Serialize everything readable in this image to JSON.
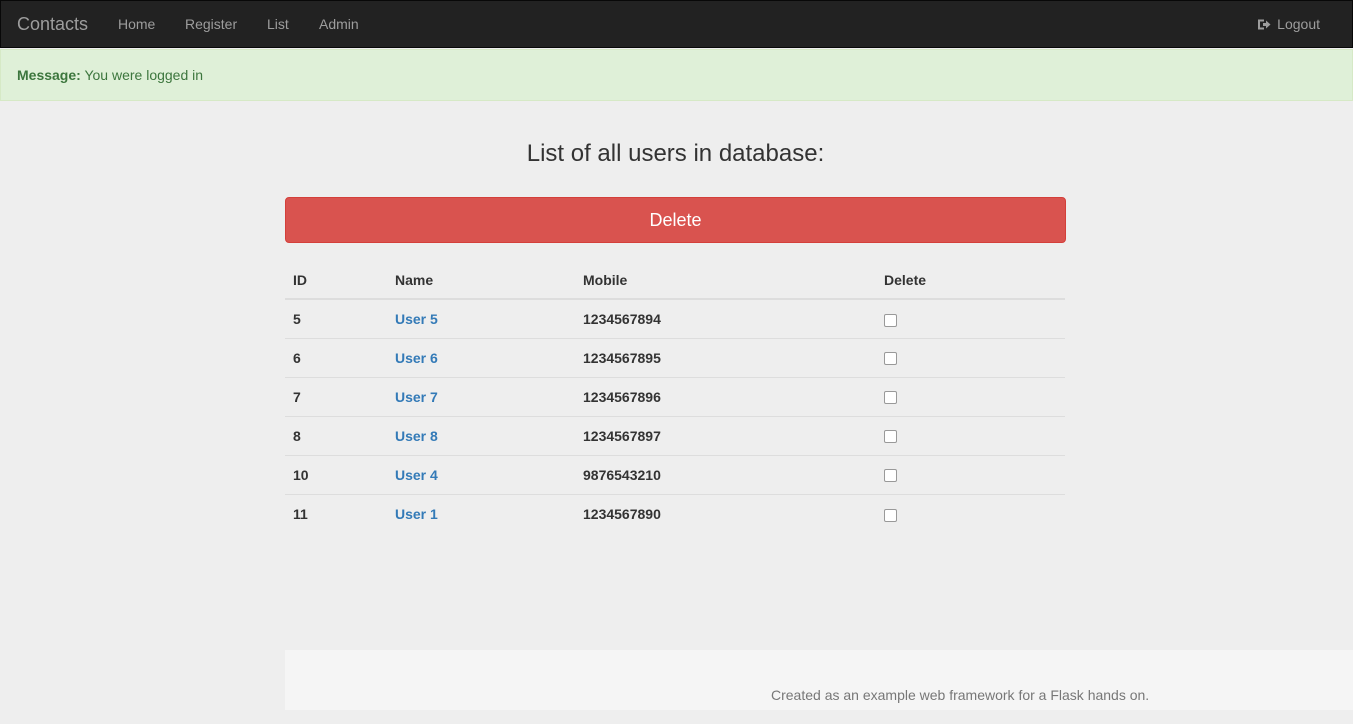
{
  "navbar": {
    "brand": "Contacts",
    "links": [
      "Home",
      "Register",
      "List",
      "Admin"
    ],
    "logout_label": "Logout",
    "logout_icon": "logout-icon"
  },
  "alert": {
    "label": "Message:",
    "text": "You were logged in"
  },
  "page_title": "List of all users in database:",
  "delete_button_label": "Delete",
  "table": {
    "headers": [
      "ID",
      "Name",
      "Mobile",
      "Delete"
    ],
    "rows": [
      {
        "id": "5",
        "name": "User 5",
        "mobile": "1234567894",
        "checked": false
      },
      {
        "id": "6",
        "name": "User 6",
        "mobile": "1234567895",
        "checked": false
      },
      {
        "id": "7",
        "name": "User 7",
        "mobile": "1234567896",
        "checked": false
      },
      {
        "id": "8",
        "name": "User 8",
        "mobile": "1234567897",
        "checked": false
      },
      {
        "id": "10",
        "name": "User 4",
        "mobile": "9876543210",
        "checked": false
      },
      {
        "id": "11",
        "name": "User 1",
        "mobile": "1234567890",
        "checked": false
      }
    ]
  },
  "footer_text": "Created as an example web framework for a Flask hands on.",
  "colors": {
    "navbar_bg": "#222222",
    "alert_bg": "#dff0d8",
    "alert_text": "#3c763d",
    "danger": "#d9534f",
    "link": "#337ab7",
    "page_bg": "#eeeeee"
  }
}
